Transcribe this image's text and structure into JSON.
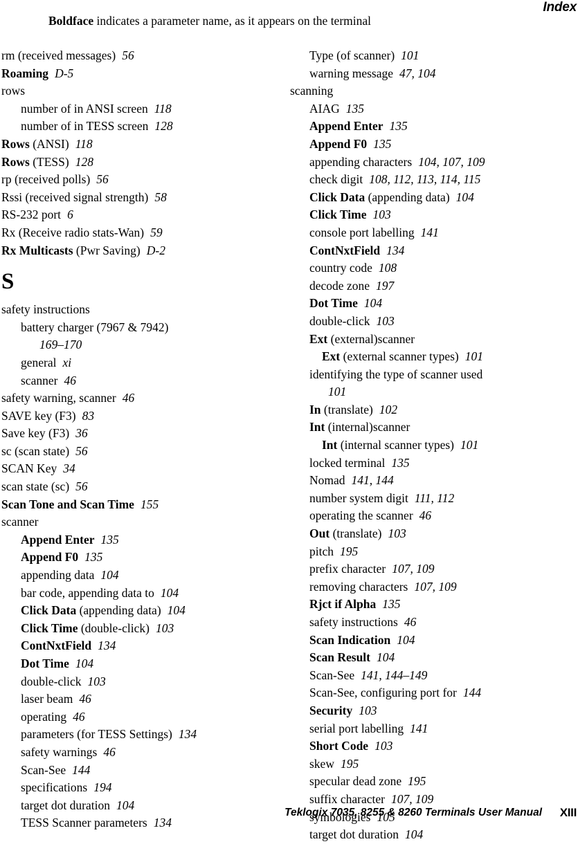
{
  "header": {
    "running_head": "Index",
    "note_bold": "Boldface",
    "note_rest": " indicates a parameter name, as it appears on the terminal"
  },
  "footer": {
    "manual_title": "Teklogix 7035, 8255 & 8260 Terminals User Manual",
    "page_number": "XIII"
  },
  "columns": {
    "left": [
      {
        "level": 0,
        "term": "rm (received messages)",
        "bold": false,
        "pages": "56"
      },
      {
        "level": 0,
        "term": "Roaming",
        "bold": true,
        "pages": "D-5"
      },
      {
        "level": 0,
        "term": "rows",
        "bold": false,
        "pages": ""
      },
      {
        "level": 1,
        "term": "number of in ANSI screen",
        "bold": false,
        "pages": "118"
      },
      {
        "level": 1,
        "term": "number of in TESS screen",
        "bold": false,
        "pages": "128"
      },
      {
        "level": 0,
        "term": "Rows",
        "bold": true,
        "qual": " (ANSI)",
        "pages": "118"
      },
      {
        "level": 0,
        "term": "Rows",
        "bold": true,
        "qual": " (TESS)",
        "pages": "128"
      },
      {
        "level": 0,
        "term": "rp (received polls)",
        "bold": false,
        "pages": "56"
      },
      {
        "level": 0,
        "term": "Rssi (received signal strength)",
        "bold": false,
        "pages": "58"
      },
      {
        "level": 0,
        "term": "RS-232 port",
        "bold": false,
        "pages": "6"
      },
      {
        "level": 0,
        "term": "Rx (Receive radio stats-Wan)",
        "bold": false,
        "pages": "59"
      },
      {
        "level": 0,
        "term": "Rx Multicasts",
        "bold": true,
        "qual": " (Pwr Saving)",
        "pages": "D-2"
      },
      {
        "level": 0,
        "letter": "S"
      },
      {
        "level": 0,
        "term": "safety instructions",
        "bold": false,
        "pages": ""
      },
      {
        "level": 1,
        "term": "battery charger (7967 & 7942)",
        "bold": false,
        "pages": ""
      },
      {
        "level": 2,
        "term": "",
        "bold": false,
        "pages": "169–170"
      },
      {
        "level": 1,
        "term": "general",
        "bold": false,
        "pages": "xi"
      },
      {
        "level": 1,
        "term": "scanner",
        "bold": false,
        "pages": "46"
      },
      {
        "level": 0,
        "term": "safety warning, scanner",
        "bold": false,
        "pages": "46"
      },
      {
        "level": 0,
        "term": "SAVE key (F3)",
        "bold": false,
        "pages": "83"
      },
      {
        "level": 0,
        "term": "Save key (F3)",
        "bold": false,
        "pages": "36"
      },
      {
        "level": 0,
        "term": "sc (scan state)",
        "bold": false,
        "pages": "56"
      },
      {
        "level": 0,
        "term": "SCAN Key",
        "bold": false,
        "pages": "34"
      },
      {
        "level": 0,
        "term": "scan state (sc)",
        "bold": false,
        "pages": "56"
      },
      {
        "level": 0,
        "term": "Scan Tone and Scan Time",
        "bold": true,
        "pages": "155"
      },
      {
        "level": 0,
        "term": "scanner",
        "bold": false,
        "pages": ""
      },
      {
        "level": 1,
        "term": "Append Enter",
        "bold": true,
        "pages": "135"
      },
      {
        "level": 1,
        "term": "Append F0",
        "bold": true,
        "pages": "135"
      },
      {
        "level": 1,
        "term": "appending data",
        "bold": false,
        "pages": "104"
      },
      {
        "level": 1,
        "term": "bar code, appending data to",
        "bold": false,
        "pages": "104"
      },
      {
        "level": 1,
        "term": "Click Data",
        "bold": true,
        "qual": " (appending data)",
        "pages": "104"
      },
      {
        "level": 1,
        "term": "Click Time",
        "bold": true,
        "qual": " (double-click)",
        "pages": "103"
      },
      {
        "level": 1,
        "term": "ContNxtField",
        "bold": true,
        "pages": "134"
      },
      {
        "level": 1,
        "term": "Dot Time",
        "bold": true,
        "pages": "104"
      },
      {
        "level": 1,
        "term": "double-click",
        "bold": false,
        "pages": "103"
      },
      {
        "level": 1,
        "term": "laser beam",
        "bold": false,
        "pages": "46"
      },
      {
        "level": 1,
        "term": "operating",
        "bold": false,
        "pages": "46"
      },
      {
        "level": 1,
        "term": "parameters (for TESS Settings)",
        "bold": false,
        "pages": "134"
      },
      {
        "level": 1,
        "term": "safety warnings",
        "bold": false,
        "pages": "46"
      },
      {
        "level": 1,
        "term": "Scan-See",
        "bold": false,
        "pages": "144"
      },
      {
        "level": 1,
        "term": "specifications",
        "bold": false,
        "pages": "194"
      },
      {
        "level": 1,
        "term": "target dot duration",
        "bold": false,
        "pages": "104"
      },
      {
        "level": 1,
        "term": "TESS Scanner parameters",
        "bold": false,
        "pages": "134"
      }
    ],
    "right": [
      {
        "level": 1,
        "term": "Type (of scanner)",
        "bold": false,
        "pages": "101"
      },
      {
        "level": 1,
        "term": "warning message",
        "bold": false,
        "pages": "47, 104"
      },
      {
        "level": 0,
        "term": "scanning",
        "bold": false,
        "pages": ""
      },
      {
        "level": 1,
        "term": "AIAG",
        "bold": false,
        "pages": "135"
      },
      {
        "level": 1,
        "term": "Append Enter",
        "bold": true,
        "pages": "135"
      },
      {
        "level": 1,
        "term": "Append F0",
        "bold": true,
        "pages": "135"
      },
      {
        "level": 1,
        "term": "appending characters",
        "bold": false,
        "pages": "104, 107, 109"
      },
      {
        "level": 1,
        "term": "check digit",
        "bold": false,
        "pages": "108, 112, 113, 114, 115"
      },
      {
        "level": 1,
        "term": "Click Data",
        "bold": true,
        "qual": " (appending data)",
        "pages": "104"
      },
      {
        "level": 1,
        "term": "Click Time",
        "bold": true,
        "pages": "103"
      },
      {
        "level": 1,
        "term": "console port labelling",
        "bold": false,
        "pages": "141"
      },
      {
        "level": 1,
        "term": "ContNxtField",
        "bold": true,
        "pages": "134"
      },
      {
        "level": 1,
        "term": "country code",
        "bold": false,
        "pages": "108"
      },
      {
        "level": 1,
        "term": "decode zone",
        "bold": false,
        "pages": "197"
      },
      {
        "level": 1,
        "term": "Dot Time",
        "bold": true,
        "pages": "104"
      },
      {
        "level": 1,
        "term": "double-click",
        "bold": false,
        "pages": "103"
      },
      {
        "level": 1,
        "term": "Ext",
        "bold": true,
        "qual": " (external)scanner",
        "pages": ""
      },
      {
        "level": 2,
        "term": "Ext",
        "bold": true,
        "qual": " (external scanner types)",
        "pages": "101"
      },
      {
        "level": 1,
        "term": "identifying the type of scanner used",
        "bold": false,
        "pages": ""
      },
      {
        "level": 2,
        "term": "",
        "bold": false,
        "pages": "101"
      },
      {
        "level": 1,
        "term": "In",
        "bold": true,
        "qual": " (translate)",
        "pages": "102"
      },
      {
        "level": 1,
        "term": "Int",
        "bold": true,
        "qual": " (internal)scanner",
        "pages": ""
      },
      {
        "level": 2,
        "term": "Int",
        "bold": true,
        "qual": " (internal scanner types)",
        "pages": "101"
      },
      {
        "level": 1,
        "term": "locked terminal",
        "bold": false,
        "pages": "135"
      },
      {
        "level": 1,
        "term": "Nomad",
        "bold": false,
        "pages": "141, 144"
      },
      {
        "level": 1,
        "term": "number system digit",
        "bold": false,
        "pages": "111, 112"
      },
      {
        "level": 1,
        "term": "operating the scanner",
        "bold": false,
        "pages": "46"
      },
      {
        "level": 1,
        "term": "Out",
        "bold": true,
        "qual": " (translate)",
        "pages": "103"
      },
      {
        "level": 1,
        "term": "pitch",
        "bold": false,
        "pages": "195"
      },
      {
        "level": 1,
        "term": "prefix character",
        "bold": false,
        "pages": "107, 109"
      },
      {
        "level": 1,
        "term": "removing characters",
        "bold": false,
        "pages": "107, 109"
      },
      {
        "level": 1,
        "term": "Rjct if Alpha",
        "bold": true,
        "pages": "135"
      },
      {
        "level": 1,
        "term": "safety instructions",
        "bold": false,
        "pages": "46"
      },
      {
        "level": 1,
        "term": "Scan Indication",
        "bold": true,
        "pages": "104"
      },
      {
        "level": 1,
        "term": "Scan Result",
        "bold": true,
        "pages": "104"
      },
      {
        "level": 1,
        "term": "Scan-See",
        "bold": false,
        "pages": "141, 144–149"
      },
      {
        "level": 1,
        "term": "Scan-See, configuring port for",
        "bold": false,
        "pages": "144"
      },
      {
        "level": 1,
        "term": "Security",
        "bold": true,
        "pages": "103"
      },
      {
        "level": 1,
        "term": "serial port labelling",
        "bold": false,
        "pages": "141"
      },
      {
        "level": 1,
        "term": "Short Code",
        "bold": true,
        "pages": "103"
      },
      {
        "level": 1,
        "term": "skew",
        "bold": false,
        "pages": "195"
      },
      {
        "level": 1,
        "term": "specular dead zone",
        "bold": false,
        "pages": "195"
      },
      {
        "level": 1,
        "term": "suffix character",
        "bold": false,
        "pages": "107, 109"
      },
      {
        "level": 1,
        "term": "symbologies",
        "bold": false,
        "pages": "105"
      },
      {
        "level": 1,
        "term": "target dot duration",
        "bold": false,
        "pages": "104"
      }
    ]
  }
}
